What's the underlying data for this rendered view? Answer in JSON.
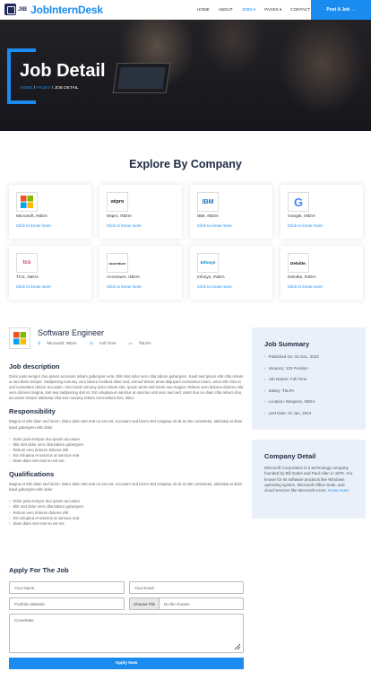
{
  "brand": {
    "mark": "JIB",
    "name": "JobInternDesk"
  },
  "nav": {
    "items": [
      "HOME",
      "ABOUT",
      "JOBS ▾",
      "PAGES ▾",
      "CONTACT"
    ],
    "active_index": 2,
    "post_button": "Post A Job →"
  },
  "hero": {
    "title": "Job Detail",
    "breadcrumb": {
      "home": "HOME",
      "sep1": " / ",
      "pages": "PAGES",
      "sep2": " / ",
      "current": "JOB DETAIL"
    }
  },
  "explore": {
    "title": "Explore By Company",
    "companies": [
      {
        "name": "Microsoft, INDIA",
        "logo": "Microsoft",
        "link": "Click to know more",
        "color": "#f25022"
      },
      {
        "name": "Wipro, INDIA",
        "logo": "wipro",
        "link": "Click to know more",
        "color": "#222222"
      },
      {
        "name": "IBM, INDIA",
        "logo": "IBM",
        "link": "Click to know more",
        "color": "#1f70c1"
      },
      {
        "name": "Google, INDIA",
        "logo": "G",
        "link": "Click to know more",
        "color": "#4285f4"
      },
      {
        "name": "TCS, INDIA",
        "logo": "tcs",
        "link": "Click to know more",
        "color": "#d6336c"
      },
      {
        "name": "Accenture, INDIA",
        "logo": "accenture",
        "link": "Click to know more",
        "color": "#333333"
      },
      {
        "name": "Infosys, INDIA",
        "logo": "Infosys",
        "link": "Click to know more",
        "color": "#007cc3"
      },
      {
        "name": "Deloitte, INDIA",
        "logo": "Deloitte.",
        "link": "Click to know more",
        "color": "#111111"
      }
    ]
  },
  "job": {
    "title": "Software Engineer",
    "location": "Microsoft, INDIA",
    "type": "Full Time",
    "salary": "₹5LPA"
  },
  "description": {
    "title": "Job description",
    "text": "Dolor justo tempor duo ipsum accusam rebum gubergren erat. Elitr stet dolor vero clita labore gubergren. Kasd sed ipsum elitr clita rebum ut sea diam tempor. Sadipscing nonumy vero labore invidunt dolor sed, eirmod dolore amet aliquyam consetetur lorem, amet elitr clita et sed consetetur dolore accusam. Vero kasd nonumy justo rebum stet. Ipsum amet sed lorem sea magna. Rebum vero dolores dolores elitr vero dolores magna, stet sea sadipscing stet et. Est voluptua et sanctus at sanctus erat vero sed sed, amet duo no diam clita rebum duo, accusam tempor takimata clita stet nonumy rebum est invidunt stet, dolor."
  },
  "responsibility": {
    "title": "Responsibility",
    "text": "Magna et elitr diam sed lorem. Diam diam stet erat no est est. Accusam sed lorem stet voluptua sit sit at stet consetetur, takimata at diam kasd gubergren elitr dolor",
    "items": [
      "Dolor justo tempor duo ipsum accusam",
      "Elitr stet dolor vero clita labore gubergren",
      "Rebum vero dolores dolores elitr",
      "Est voluptua et sanctus at sanctus erat",
      "Diam diam stet erat no est est"
    ]
  },
  "qualifications": {
    "title": "Qualifications",
    "text": "Magna et elitr diam sed lorem. Diam diam stet erat no est est. Accusam sed lorem stet voluptua sit sit at stet consetetur, takimata at diam kasd gubergren elitr dolor",
    "items": [
      "Dolor justo tempor duo ipsum accusam",
      "Elitr stet dolor vero clita labore gubergren",
      "Rebum vero dolores dolores elitr",
      "Est voluptua et sanctus at sanctus erat",
      "Diam diam stet erat no est est"
    ]
  },
  "summary": {
    "title": "Job Summary",
    "items": [
      "Published On: 01 Dec, 2023",
      "Vacancy: 133 Position",
      "Job Nature: Full Time",
      "Salary: ₹5LPA",
      "Location: Banglore, INDIA",
      "Last Date: 01 Jan, 2024"
    ]
  },
  "company": {
    "title": "Company Detail",
    "text": "Microsoft Corporation is a technology company founded by Bill Gates and Paul Allen in 1975. It is known for its software products like Windows operating system, Microsoft Office Suite, and cloud services like Microsoft Azure.",
    "link": "Know more"
  },
  "form": {
    "title": "Apply For The Job",
    "name_placeholder": "Your Name",
    "email_placeholder": "Your Email",
    "portfolio_placeholder": "Portfolio Website",
    "file_button": "Choose File",
    "file_status": "No file chosen",
    "cover_placeholder": "Coverletter",
    "submit": "Apply Now"
  },
  "colors": {
    "accent": "#1a8cf0",
    "heading": "#1f2a44",
    "sidebar_bg": "#eaf0f9"
  }
}
